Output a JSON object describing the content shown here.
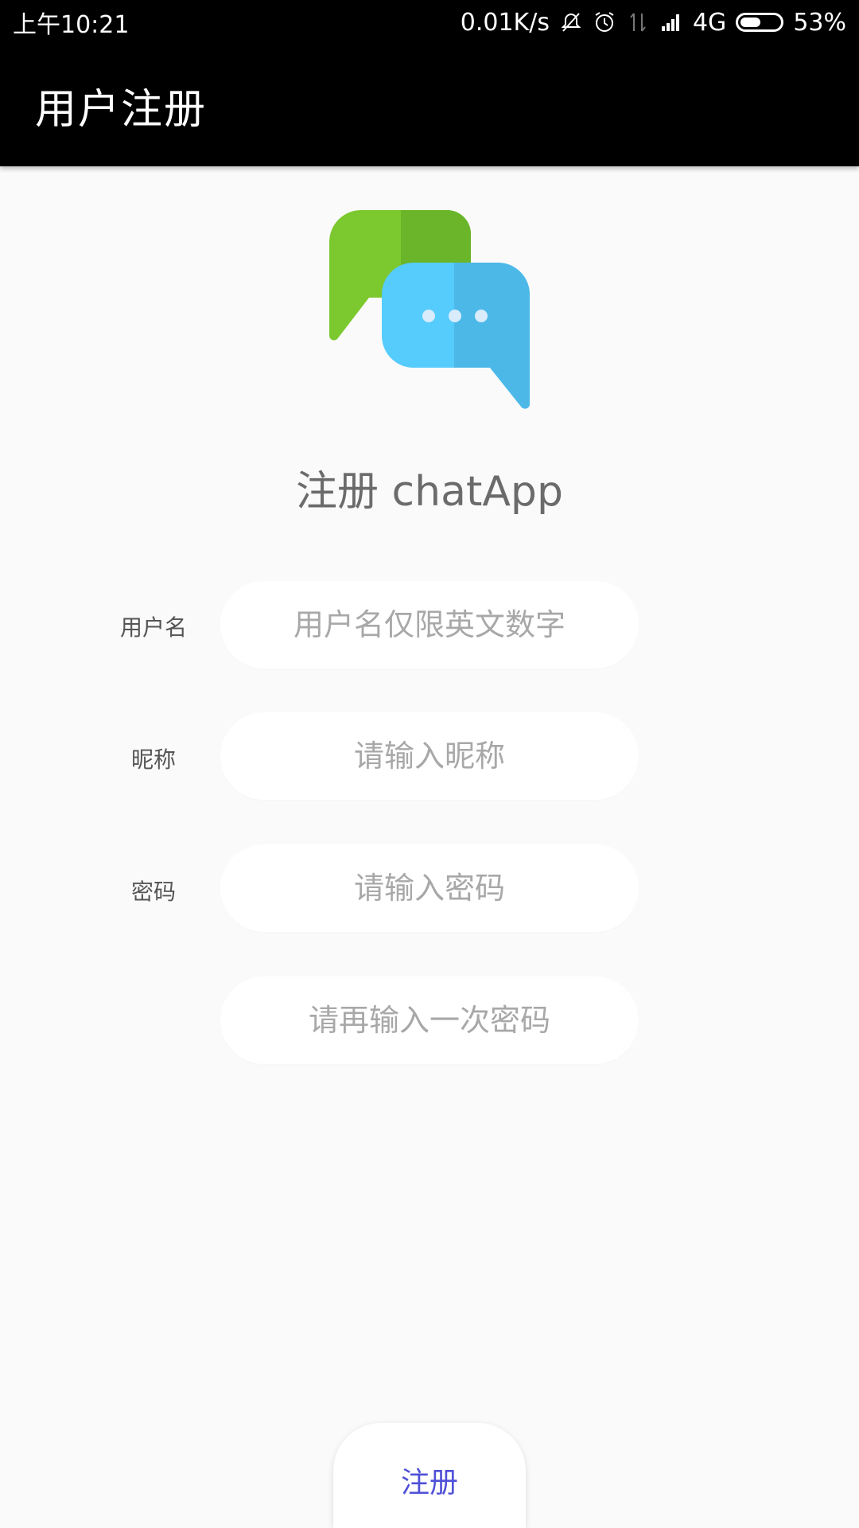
{
  "status_bar": {
    "time": "上午10:21",
    "net_speed": "0.01K/s",
    "network": "4G",
    "battery_percent": "53%",
    "battery_level": 0.53,
    "icons": [
      "mute-icon",
      "alarm-icon",
      "data-arrows-icon",
      "signal-icon",
      "battery-icon"
    ]
  },
  "app_bar": {
    "title": "用户注册"
  },
  "logo": {
    "icon": "chat-bubbles-icon",
    "colors": {
      "green": "#7cc82f",
      "green_dark": "#6ab52a",
      "blue": "#56ccfd",
      "blue_dark": "#4cb8e8",
      "dots": "#d9ecfb"
    }
  },
  "heading": "注册 chatApp",
  "form": {
    "username": {
      "label": "用户名",
      "placeholder": "用户名仅限英文数字",
      "value": ""
    },
    "nickname": {
      "label": "昵称",
      "placeholder": "请输入昵称",
      "value": ""
    },
    "password": {
      "label": "密码",
      "placeholder": "请输入密码",
      "value": ""
    },
    "password_confirm": {
      "placeholder": "请再输入一次密码",
      "value": ""
    }
  },
  "register_button": {
    "label": "注册",
    "color": "#5050d8"
  }
}
